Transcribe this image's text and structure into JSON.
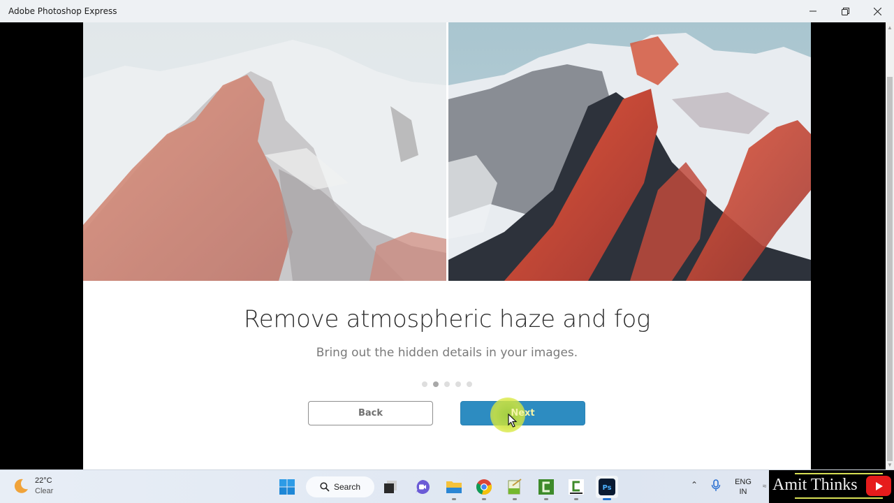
{
  "window": {
    "title": "Adobe Photoshop Express",
    "controls": {
      "minimize": "minimize",
      "maximize": "restore",
      "close": "close"
    }
  },
  "onboarding": {
    "images": {
      "before_alt": "Hazy snowy mountain (before)",
      "after_alt": "Dehazed snowy mountain (after)"
    },
    "headline": "Remove atmospheric haze and fog",
    "subline": "Bring out the hidden details in your images.",
    "pager": {
      "total": 5,
      "current": 2
    },
    "back_label": "Back",
    "next_label": "Next",
    "colors": {
      "next_button": "#2d8cc1",
      "back_border": "#8e8e8e"
    }
  },
  "taskbar": {
    "weather": {
      "temp": "22°C",
      "desc": "Clear",
      "icon": "moon-icon"
    },
    "search_label": "Search",
    "apps": [
      {
        "name": "start",
        "icon": "windows-start-icon"
      },
      {
        "name": "task-view",
        "icon": "task-view-icon"
      },
      {
        "name": "meet",
        "icon": "video-chat-icon"
      },
      {
        "name": "file-explorer",
        "icon": "folder-icon"
      },
      {
        "name": "chrome",
        "icon": "chrome-icon"
      },
      {
        "name": "notepad-plus",
        "icon": "notepad-icon"
      },
      {
        "name": "camtasia-1",
        "icon": "camtasia-icon"
      },
      {
        "name": "camtasia-2",
        "icon": "camtasia-recorder-icon"
      },
      {
        "name": "photoshop-express",
        "icon": "photoshop-icon",
        "label": "Ps",
        "active": true
      }
    ],
    "lang_top": "ENG",
    "lang_bottom": "IN"
  },
  "watermark": {
    "text": "Amit Thinks",
    "icon": "youtube-icon"
  }
}
